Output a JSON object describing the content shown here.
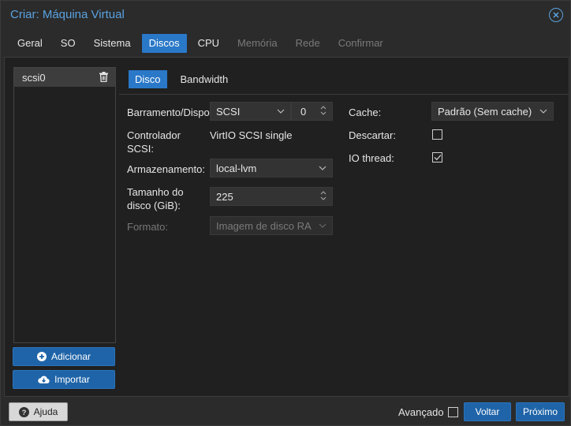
{
  "window": {
    "title": "Criar: Máquina Virtual"
  },
  "tabs": [
    {
      "label": "Geral",
      "state": "normal"
    },
    {
      "label": "SO",
      "state": "normal"
    },
    {
      "label": "Sistema",
      "state": "normal"
    },
    {
      "label": "Discos",
      "state": "active"
    },
    {
      "label": "CPU",
      "state": "normal"
    },
    {
      "label": "Memória",
      "state": "disabled"
    },
    {
      "label": "Rede",
      "state": "disabled"
    },
    {
      "label": "Confirmar",
      "state": "disabled"
    }
  ],
  "disk_list": {
    "items": [
      {
        "label": "scsi0"
      }
    ]
  },
  "buttons": {
    "add": "Adicionar",
    "import": "Importar"
  },
  "subtabs": {
    "disco": "Disco",
    "bandwidth": "Bandwidth"
  },
  "form": {
    "bus_label": "Barramento/Dispo",
    "bus_value": "SCSI",
    "device_value": "0",
    "controller_label_1": "Controlador",
    "controller_label_2": "SCSI:",
    "controller_value": "VirtIO SCSI single",
    "storage_label": "Armazenamento:",
    "storage_value": "local-lvm",
    "size_label_1": "Tamanho do",
    "size_label_2": "disco (GiB):",
    "size_value": "225",
    "format_label": "Formato:",
    "format_value": "Imagem de disco RA",
    "cache_label": "Cache:",
    "cache_value": "Padrão (Sem cache)",
    "discard_label": "Descartar:",
    "discard_checked": false,
    "iothread_label": "IO thread:",
    "iothread_checked": true
  },
  "footer": {
    "help": "Ajuda",
    "advanced_label": "Avançado",
    "advanced_checked": false,
    "back": "Voltar",
    "next": "Próximo"
  },
  "colors": {
    "accent": "#2a78c8",
    "title": "#5aa2e0",
    "button": "#1f64a8"
  }
}
